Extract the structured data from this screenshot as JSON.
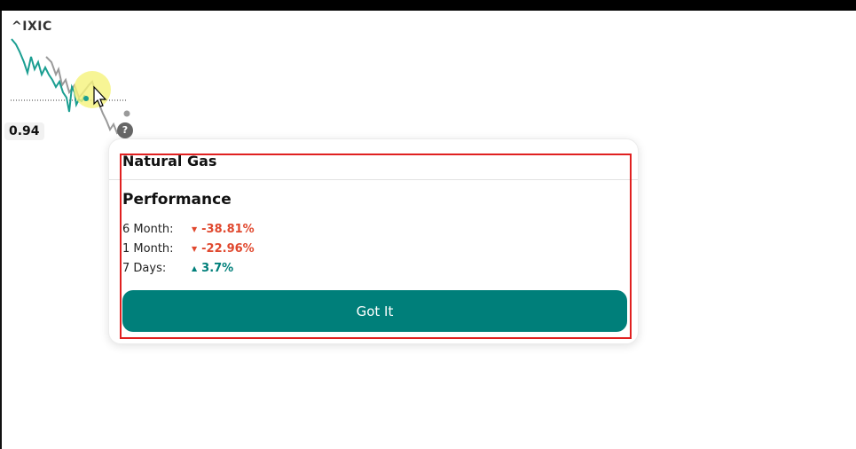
{
  "ticker": {
    "symbol": "^IXIC"
  },
  "badges": {
    "value": "0.94",
    "help": "?"
  },
  "tooltip": {
    "title": "Natural Gas",
    "section_title": "Performance",
    "rows": [
      {
        "label": "6 Month:",
        "value": "-38.81%",
        "direction": "down"
      },
      {
        "label": "1 Month:",
        "value": "-22.96%",
        "direction": "down"
      },
      {
        "label": "7 Days:",
        "value": "3.7%",
        "direction": "up"
      }
    ],
    "button_label": "Got It"
  },
  "colors": {
    "accent": "#007f7a",
    "negative": "#e0482e",
    "positive": "#007f7a",
    "highlight": "#e02020",
    "cursor_glow": "#f5f27a"
  }
}
